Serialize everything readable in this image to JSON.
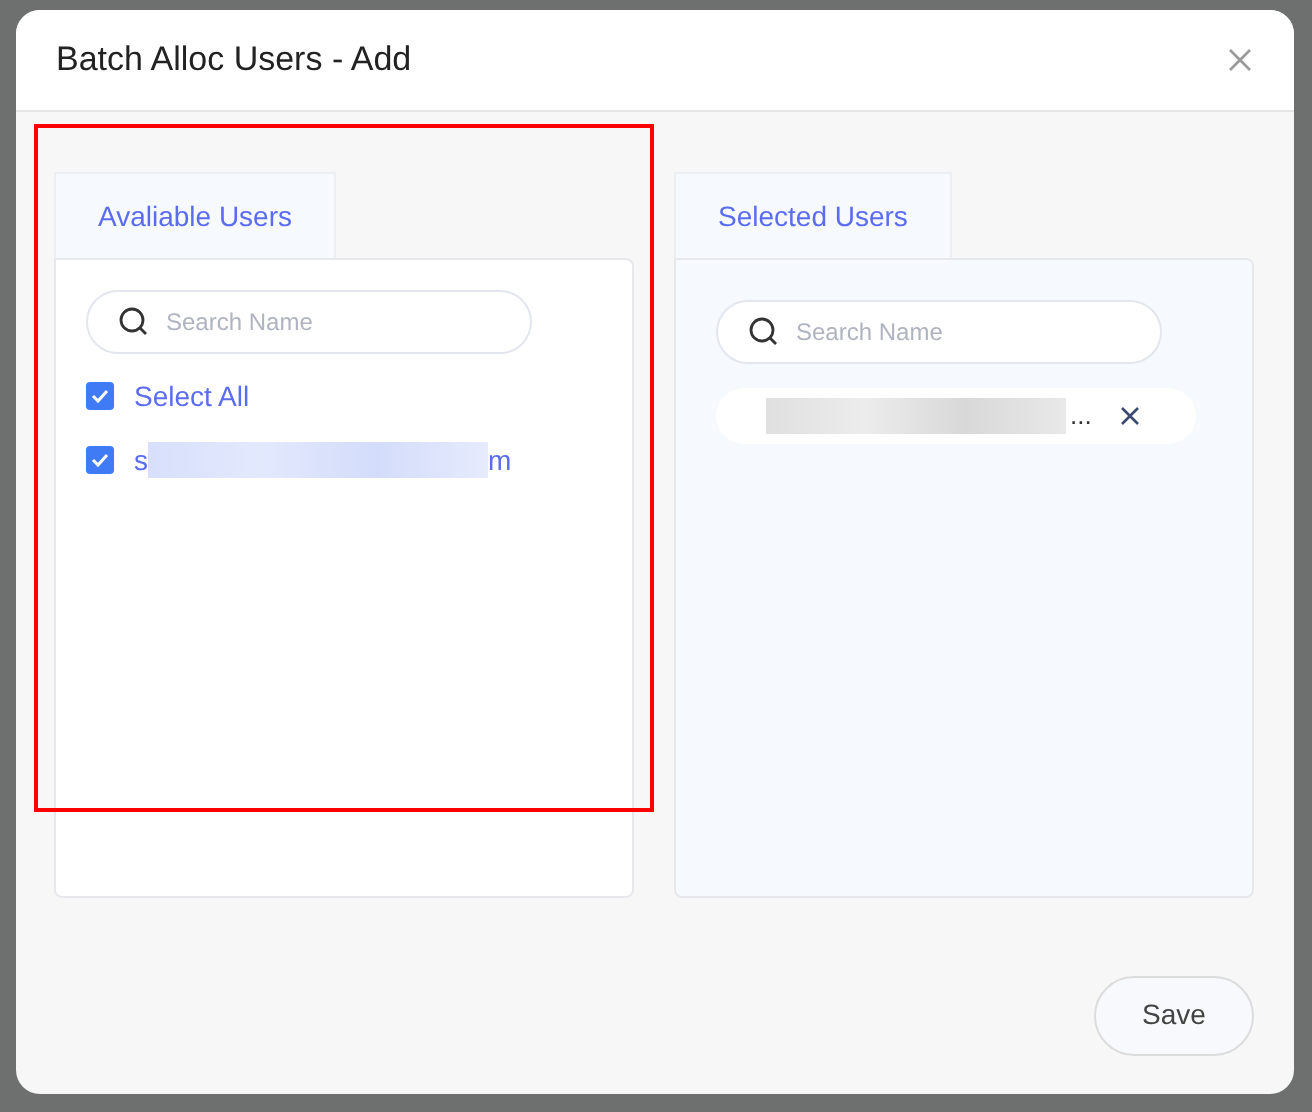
{
  "dialog": {
    "title": "Batch Alloc Users - Add"
  },
  "available": {
    "tab": "Avaliable Users",
    "search": {
      "placeholder": "Search Name"
    },
    "select_all": {
      "label": "Select All",
      "checked": true
    },
    "users": [
      {
        "label_start": "s",
        "label_end": "m",
        "checked": true
      }
    ]
  },
  "selected": {
    "tab": "Selected Users",
    "search": {
      "placeholder": "Search Name"
    },
    "chips": [
      {
        "label_end": "..."
      }
    ]
  },
  "highlight": {
    "on": true
  },
  "buttons": {
    "save": "Save"
  }
}
